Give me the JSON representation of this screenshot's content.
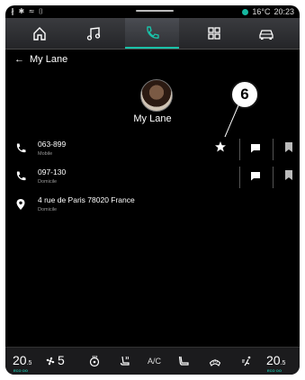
{
  "status_bar": {
    "left_icons": "∦ ✱ ≈ ⌷",
    "temperature": "16°C",
    "time": "20:23"
  },
  "nav_tabs": [
    {
      "icon": "home-icon",
      "active": false
    },
    {
      "icon": "music-icon",
      "active": false
    },
    {
      "icon": "phone-icon",
      "active": true
    },
    {
      "icon": "apps-grid-icon",
      "active": false
    },
    {
      "icon": "car-icon",
      "active": false
    }
  ],
  "header": {
    "back_title": "My Lane"
  },
  "contact": {
    "name": "My Lane"
  },
  "callout": {
    "number": "6"
  },
  "entries": [
    {
      "type": "phone",
      "value": "063-899",
      "label": "Mobile",
      "favorite": true
    },
    {
      "type": "phone",
      "value": "097-130",
      "label": "Domicile",
      "favorite": false
    },
    {
      "type": "address",
      "value": "4 rue de Paris 78020 France",
      "label": "Domicile"
    }
  ],
  "climate": {
    "left_temp": "20",
    "left_temp_decimal": ".5",
    "left_mode": "ECO OO",
    "fan_level": "5",
    "ac_label": "A/C",
    "right_temp": "20",
    "right_temp_decimal": ".5",
    "right_mode": "ECO OO"
  },
  "colors": {
    "accent": "#19c1a8",
    "background": "#000000"
  }
}
